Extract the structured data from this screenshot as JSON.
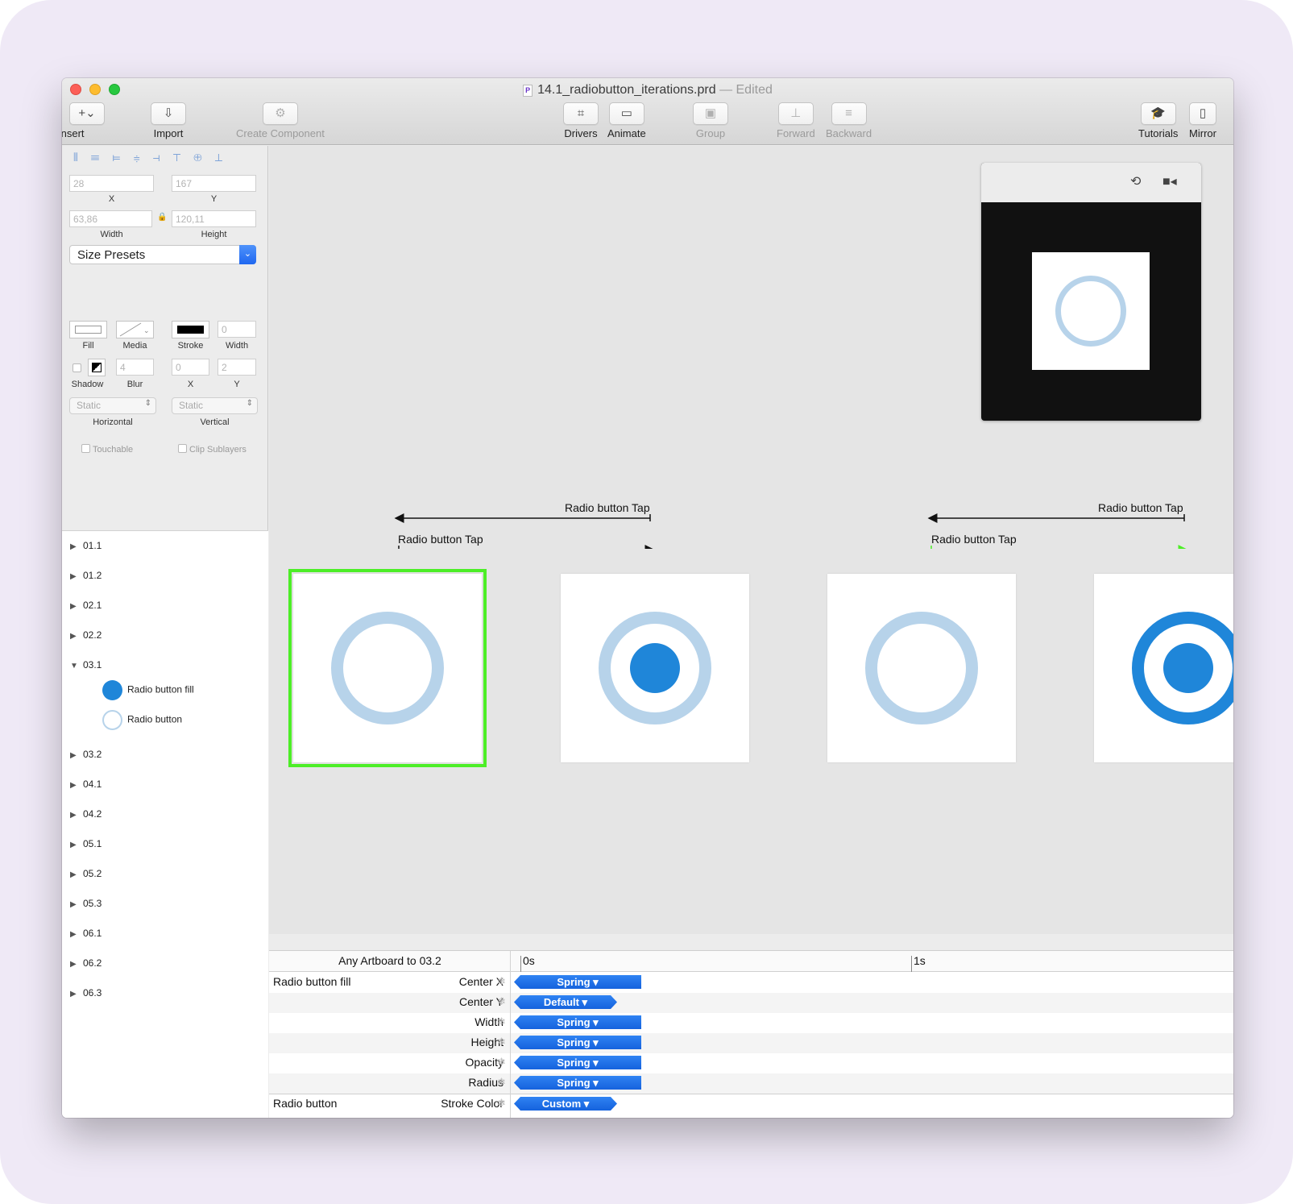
{
  "window": {
    "title": "14.1_radiobutton_iterations.prd",
    "title_suffix": "— Edited",
    "doc_icon": "P"
  },
  "toolbar": {
    "insert": "Insert",
    "insert_glyph": "+⌄",
    "import": "Import",
    "create_component": "Create Component",
    "drivers": "Drivers",
    "animate": "Animate",
    "group": "Group",
    "forward": "Forward",
    "backward": "Backward",
    "tutorials": "Tutorials",
    "mirror": "Mirror"
  },
  "inspector": {
    "x_value": "28",
    "y_value": "167",
    "x_label": "X",
    "y_label": "Y",
    "width_value": "63,86",
    "height_value": "120,11",
    "width_label": "Width",
    "height_label": "Height",
    "size_presets": "Size Presets",
    "fill_label": "Fill",
    "media_label": "Media",
    "stroke_label": "Stroke",
    "stroke_width_label": "Width",
    "stroke_width_value": "0",
    "shadow_label": "Shadow",
    "blur_label": "Blur",
    "blur_value": "4",
    "shadow_x_label": "X",
    "shadow_x_value": "0",
    "shadow_y_label": "Y",
    "shadow_y_value": "2",
    "horizontal_select": "Static",
    "vertical_select": "Static",
    "horizontal_label": "Horizontal",
    "vertical_label": "Vertical",
    "touchable": "Touchable",
    "clip_sublayers": "Clip Sublayers"
  },
  "layers": {
    "items": [
      "01.1",
      "01.2",
      "02.1",
      "02.2",
      "03.1",
      "03.2",
      "04.1",
      "04.2",
      "05.1",
      "05.2",
      "05.3",
      "06.1",
      "06.2",
      "06.3"
    ],
    "children": [
      "Radio button fill",
      "Radio button"
    ]
  },
  "canvas": {
    "connections": [
      "Radio button Tap",
      "Radio button Tap",
      "Radio button Tap",
      "Radio button Tap"
    ]
  },
  "timeline": {
    "header": "Any Artboard to 03.2",
    "tick_0": "0s",
    "tick_1": "1s",
    "layer_1": "Radio button fill",
    "layer_2": "Radio button",
    "rows": [
      {
        "prop": "Center X",
        "curve": "Spring ▾"
      },
      {
        "prop": "Center Y",
        "curve": "Default ▾"
      },
      {
        "prop": "Width",
        "curve": "Spring ▾"
      },
      {
        "prop": "Height",
        "curve": "Spring ▾"
      },
      {
        "prop": "Opacity",
        "curve": "Spring ▾"
      },
      {
        "prop": "Radius",
        "curve": "Spring ▾"
      },
      {
        "prop": "Stroke Color",
        "curve": "Custom ▾"
      }
    ]
  },
  "colors": {
    "selection": "#4dee27",
    "ring_light": "#b7d3ea",
    "ring_blue": "#1f86d9",
    "bar_blue": "#1a6fe5"
  }
}
